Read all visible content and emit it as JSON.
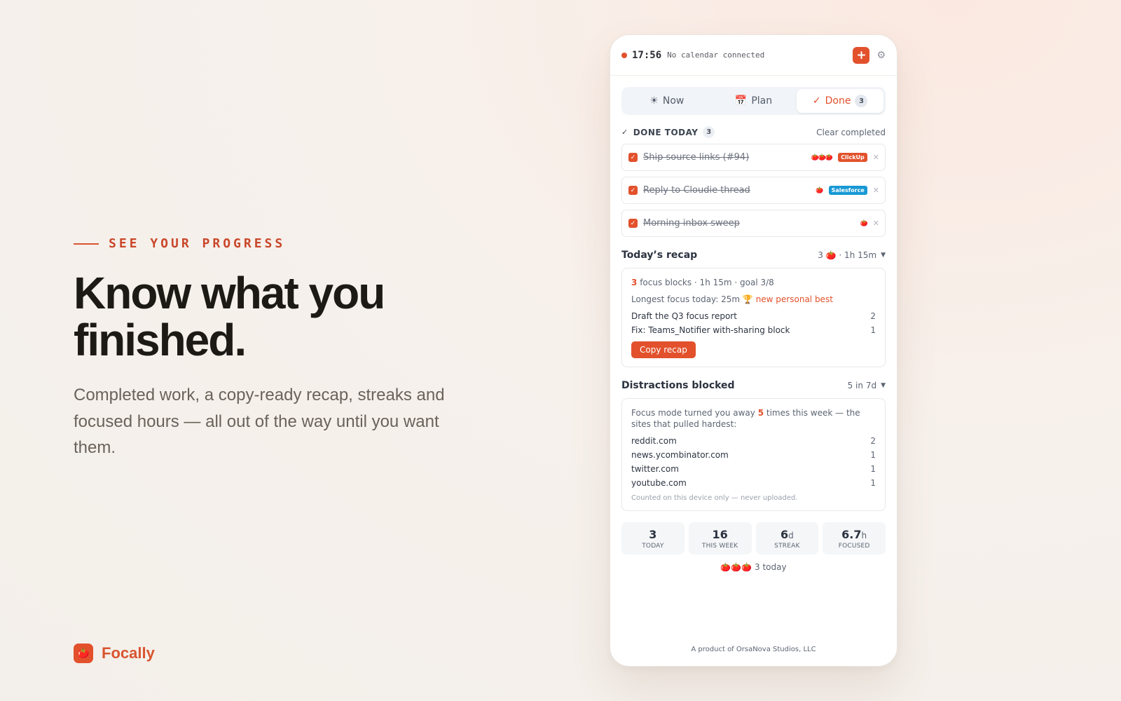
{
  "hero": {
    "eyebrow": "SEE YOUR PROGRESS",
    "headline": "Know what you finished.",
    "subhead": "Completed work, a copy-ready recap, streaks and focused hours — all out of the way until you want them."
  },
  "brand": {
    "name": "Focally",
    "logo_icon": "tomato-icon",
    "accent_color": "#e2512c"
  },
  "topbar": {
    "time": "17:56",
    "calendar_status": "No calendar connected",
    "add_label": "+",
    "settings_icon": "gear-icon"
  },
  "tabs": [
    {
      "label": "Now",
      "icon": "☀"
    },
    {
      "label": "Plan",
      "icon": "📅"
    },
    {
      "label": "Done",
      "icon": "✓",
      "badge": "3",
      "active": true
    }
  ],
  "done_today": {
    "heading": "DONE TODAY",
    "count": "3",
    "clear_label": "Clear completed",
    "tasks": [
      {
        "title": "Ship source links (#94)",
        "tomatoes": "🍅🍅🍅",
        "tag": "ClickUp"
      },
      {
        "title": "Reply to Cloudie thread",
        "tomatoes": "🍅",
        "tag": "Salesforce"
      },
      {
        "title": "Morning inbox sweep",
        "tomatoes": "🍅",
        "tag": ""
      }
    ]
  },
  "recap": {
    "title": "Today’s recap",
    "summary": "3 🍅 · 1h 15m",
    "blocks_count": "3",
    "blocks_text": "focus blocks · 1h 15m · goal 3/8",
    "longest_text": "Longest focus today: 25m 🏆",
    "best_text": "new personal best",
    "items": [
      {
        "name": "Draft the Q3 focus report",
        "count": "2"
      },
      {
        "name": "Fix: Teams_Notifier with-sharing block",
        "count": "1"
      }
    ],
    "copy_label": "Copy recap"
  },
  "distractions": {
    "title": "Distractions blocked",
    "summary": "5 in 7d",
    "intro_before": "Focus mode turned you away",
    "intro_count": "5",
    "intro_after": "times this week — the sites that pulled hardest:",
    "sites": [
      {
        "name": "reddit.com",
        "count": "2"
      },
      {
        "name": "news.ycombinator.com",
        "count": "1"
      },
      {
        "name": "twitter.com",
        "count": "1"
      },
      {
        "name": "youtube.com",
        "count": "1"
      }
    ],
    "footnote": "Counted on this device only — never uploaded."
  },
  "stats": [
    {
      "value": "3",
      "unit": "",
      "label": "TODAY"
    },
    {
      "value": "16",
      "unit": "",
      "label": "THIS WEEK"
    },
    {
      "value": "6",
      "unit": "d",
      "label": "STREAK"
    },
    {
      "value": "6.7",
      "unit": "h",
      "label": "FOCUSED"
    }
  ],
  "today_tomatoes": "🍅🍅🍅 3 today",
  "footer": "A product of OrsaNova Studios, LLC"
}
